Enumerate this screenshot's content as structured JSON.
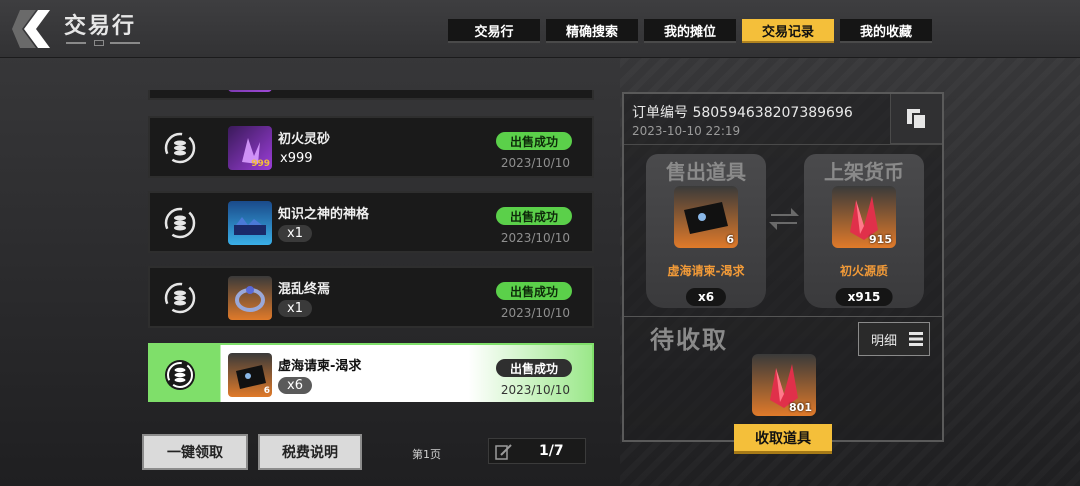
{
  "header": {
    "title": "交易行",
    "tabs": [
      {
        "label": "交易行",
        "active": false
      },
      {
        "label": "精确搜索",
        "active": false
      },
      {
        "label": "我的摊位",
        "active": false
      },
      {
        "label": "交易记录",
        "active": true
      },
      {
        "label": "我的收藏",
        "active": false
      }
    ]
  },
  "records": [
    {
      "name": "初火灵砂",
      "qty": "x999",
      "icon_badge": "999",
      "status": "出售成功",
      "date": "2023/10/10",
      "icon": "purple-crystal-icon"
    },
    {
      "name": "知识之神的神格",
      "qty": "x1",
      "icon_badge": "",
      "status": "出售成功",
      "date": "2023/10/10",
      "icon": "blue-relic-icon"
    },
    {
      "name": "混乱终焉",
      "qty": "x1",
      "icon_badge": "",
      "status": "出售成功",
      "date": "2023/10/10",
      "icon": "ring-icon"
    },
    {
      "name": "虚海请柬-渴求",
      "qty": "x6",
      "icon_badge": "6",
      "status": "出售成功",
      "date": "2023/10/10",
      "icon": "black-card-icon",
      "selected": true
    }
  ],
  "bottom": {
    "claim_all": "一键领取",
    "tax_info": "税费说明",
    "page_label": "第1页",
    "pager": "1/7"
  },
  "detail": {
    "order_no": "订单编号 580594638207389696",
    "order_time": "2023-10-10 22:19",
    "sold": {
      "title": "售出道具",
      "name": "虚海请柬-渴求",
      "qty": "x6",
      "badge": "6"
    },
    "listed": {
      "title": "上架货币",
      "name": "初火源质",
      "qty": "x915",
      "badge": "915"
    },
    "pending_title": "待收取",
    "detail_label": "明细",
    "pending_badge": "801",
    "collect_label": "收取道具"
  },
  "colors": {
    "accent_yellow": "#f4bf3a",
    "status_green": "#5bd04a",
    "item_orange": "#f19a38"
  }
}
